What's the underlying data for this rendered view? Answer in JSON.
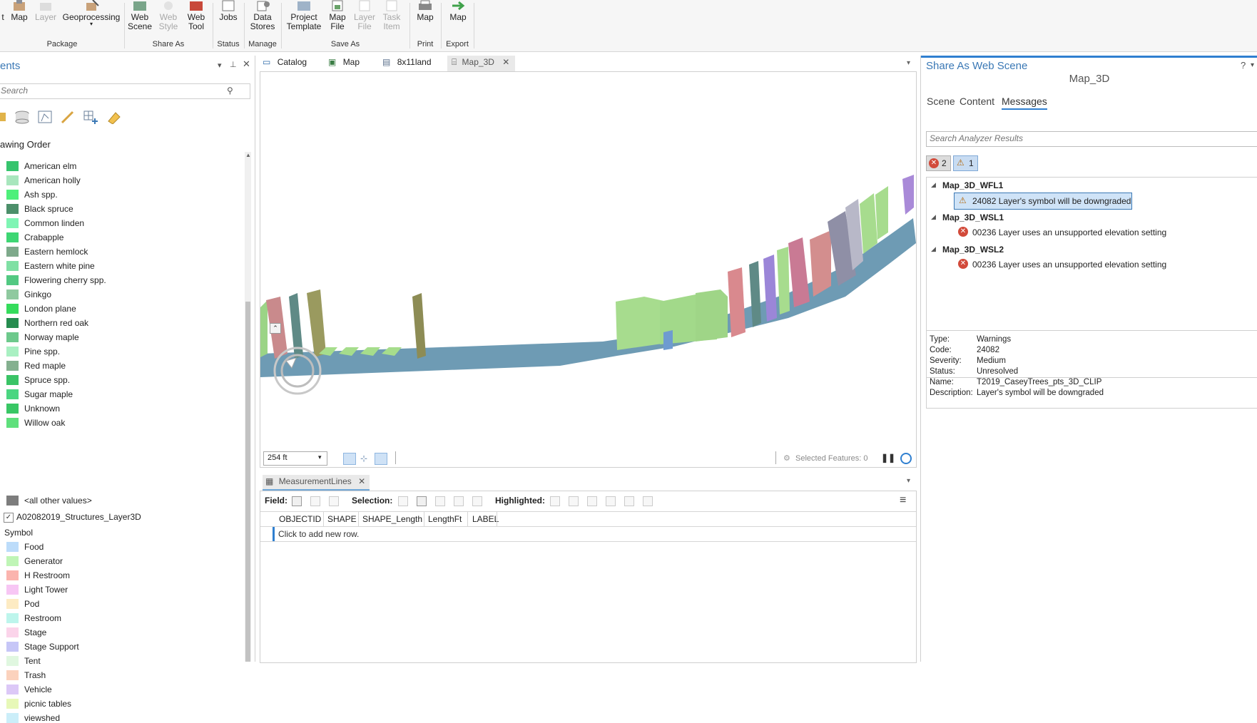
{
  "ribbon": {
    "buttons": [
      {
        "label": "t",
        "enabled": true
      },
      {
        "label": "Map",
        "enabled": true
      },
      {
        "label": "Layer",
        "enabled": false
      },
      {
        "label": "Geoprocessing",
        "enabled": true
      },
      {
        "label": "Web\nScene",
        "enabled": true
      },
      {
        "label": "Web\nStyle",
        "enabled": false
      },
      {
        "label": "Web\nTool",
        "enabled": true
      },
      {
        "label": "Jobs",
        "enabled": true
      },
      {
        "label": "Data\nStores",
        "enabled": true
      },
      {
        "label": "Project\nTemplate",
        "enabled": true
      },
      {
        "label": "Map\nFile",
        "enabled": true
      },
      {
        "label": "Layer\nFile",
        "enabled": false
      },
      {
        "label": "Task\nItem",
        "enabled": false
      },
      {
        "label": "Map",
        "enabled": true
      },
      {
        "label": "Map",
        "enabled": true
      }
    ],
    "groups": [
      "Package",
      "Share As",
      "Status",
      "Manage",
      "Save As",
      "Print",
      "Export"
    ]
  },
  "contents": {
    "title": "ents",
    "search_placeholder": "Search",
    "drawing_order": "awing Order",
    "tree_items": [
      {
        "label": "American elm",
        "color": "#36c46d"
      },
      {
        "label": "American holly",
        "color": "#a8e6bd"
      },
      {
        "label": "Ash spp.",
        "color": "#4ef07a"
      },
      {
        "label": "Black spruce",
        "color": "#4c8f6a"
      },
      {
        "label": "Common linden",
        "color": "#7ff5b4"
      },
      {
        "label": "Crabapple",
        "color": "#3ed673"
      },
      {
        "label": "Eastern hemlock",
        "color": "#7ea98b"
      },
      {
        "label": "Eastern white pine",
        "color": "#7fe0a4"
      },
      {
        "label": "Flowering cherry spp.",
        "color": "#52c982"
      },
      {
        "label": "Ginkgo",
        "color": "#8fc99f"
      },
      {
        "label": "London plane",
        "color": "#35dc5c"
      },
      {
        "label": "Northern red oak",
        "color": "#268c4f"
      },
      {
        "label": "Norway maple",
        "color": "#6dc98c"
      },
      {
        "label": "Pine spp.",
        "color": "#a9f0c2"
      },
      {
        "label": "Red maple",
        "color": "#84b08f"
      },
      {
        "label": "Spruce spp.",
        "color": "#3ac466"
      },
      {
        "label": "Sugar maple",
        "color": "#4bd681"
      },
      {
        "label": "Unknown",
        "color": "#39c765"
      },
      {
        "label": "Willow oak",
        "color": "#5fe07c"
      }
    ],
    "other_values": {
      "label": "<all other values>",
      "color": "#7d7d7d"
    },
    "layer": {
      "label": "A02082019_Structures_Layer3D",
      "checked": true
    },
    "symbol_header": "Symbol",
    "symbol_items": [
      {
        "label": "Food",
        "color": "#bcdcfa"
      },
      {
        "label": "Generator",
        "color": "#bff5b6"
      },
      {
        "label": "H Restroom",
        "color": "#fbb4ae"
      },
      {
        "label": "Light Tower",
        "color": "#f7c6f4"
      },
      {
        "label": "Pod",
        "color": "#fdebc3"
      },
      {
        "label": "Restroom",
        "color": "#bdf5ec"
      },
      {
        "label": "Stage",
        "color": "#fbd4ea"
      },
      {
        "label": "Stage Support",
        "color": "#c6c6f7"
      },
      {
        "label": "Tent",
        "color": "#e0f7e0"
      },
      {
        "label": "Trash",
        "color": "#fbd2bd"
      },
      {
        "label": "Vehicle",
        "color": "#dcc8f7"
      },
      {
        "label": "picnic tables",
        "color": "#e7f8b8"
      },
      {
        "label": "viewshed",
        "color": "#cbeef9"
      }
    ]
  },
  "views": {
    "tabs": [
      {
        "label": "Catalog",
        "icon": "folder-icon",
        "active": false
      },
      {
        "label": "Map",
        "icon": "map-icon",
        "active": false
      },
      {
        "label": "8x11land",
        "icon": "layout-icon",
        "active": false
      },
      {
        "label": "Map_3D",
        "icon": "scene-icon",
        "active": true
      }
    ],
    "scale": "254 ft",
    "selected_features": "Selected Features: 0"
  },
  "table": {
    "tab_label": "MeasurementLines",
    "field_label": "Field:",
    "selection_label": "Selection:",
    "highlighted_label": "Highlighted:",
    "columns": [
      "OBJECTID",
      "SHAPE",
      "SHAPE_Length",
      "LengthFt",
      "LABEL"
    ],
    "new_row_text": "Click to add new row."
  },
  "share_pane": {
    "title": "Share As Web Scene",
    "help": "?",
    "item_name": "Map_3D",
    "tabs": [
      "Scene",
      "Content",
      "Messages"
    ],
    "active_tab": "Messages",
    "search_placeholder": "Search Analyzer Results",
    "error_count": "2",
    "warning_count": "1",
    "groups": [
      {
        "name": "Map_3D_WFL1",
        "message": {
          "type": "warning",
          "text": "24082 Layer's symbol will be downgraded",
          "selected": true
        }
      },
      {
        "name": "Map_3D_WSL1",
        "message": {
          "type": "error",
          "text": "00236 Layer uses an unsupported elevation setting",
          "selected": false
        }
      },
      {
        "name": "Map_3D_WSL2",
        "message": {
          "type": "error",
          "text": "00236 Layer uses an unsupported elevation setting",
          "selected": false
        }
      }
    ],
    "details": [
      {
        "key": "Type:",
        "value": "Warnings"
      },
      {
        "key": "Code:",
        "value": "24082"
      },
      {
        "key": "Severity:",
        "value": "Medium"
      },
      {
        "key": "Status:",
        "value": "Unresolved"
      },
      {
        "key": "Name:",
        "value": "T2019_CaseyTrees_pts_3D_CLIP"
      },
      {
        "key": "Description:",
        "value": "Layer's symbol will be downgraded"
      }
    ]
  }
}
